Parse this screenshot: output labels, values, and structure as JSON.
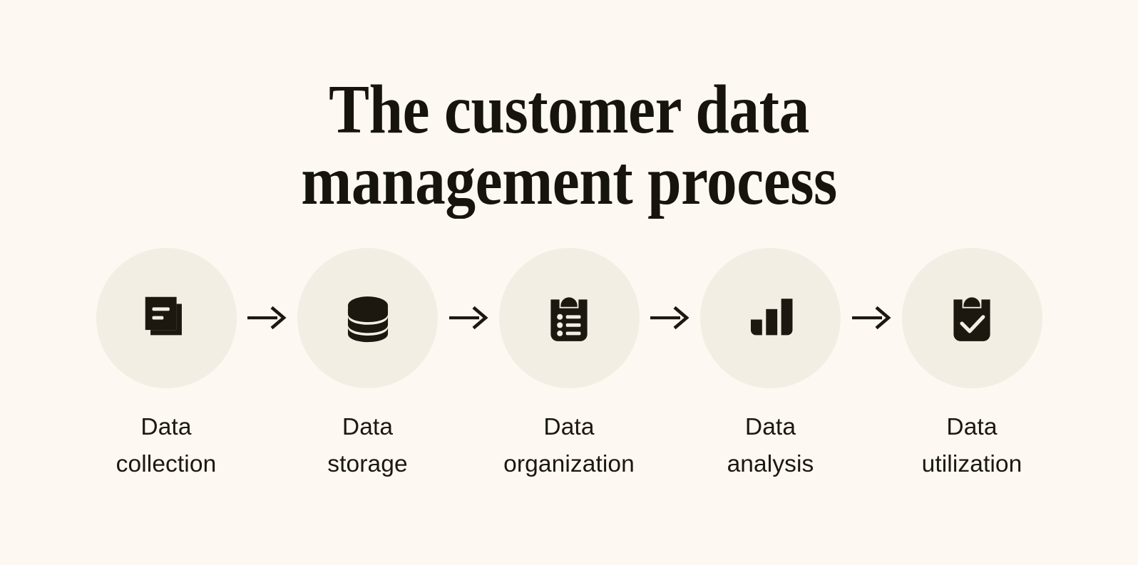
{
  "page": {
    "background_color": "#FDF8F2",
    "ink_color": "#1C1810",
    "circle_color": "#F3EEE3"
  },
  "header": {
    "title": "The customer data\nmanagement process"
  },
  "process": {
    "arrow_icon": "arrow-right-icon",
    "steps": [
      {
        "index": 1,
        "label": "Data\ncollection",
        "icon": "documents-icon"
      },
      {
        "index": 2,
        "label": "Data\nstorage",
        "icon": "database-stack-icon"
      },
      {
        "index": 3,
        "label": "Data\norganization",
        "icon": "clipboard-list-icon"
      },
      {
        "index": 4,
        "label": "Data\nanalysis",
        "icon": "bar-chart-icon"
      },
      {
        "index": 5,
        "label": "Data\nutilization",
        "icon": "clipboard-check-icon"
      }
    ]
  }
}
